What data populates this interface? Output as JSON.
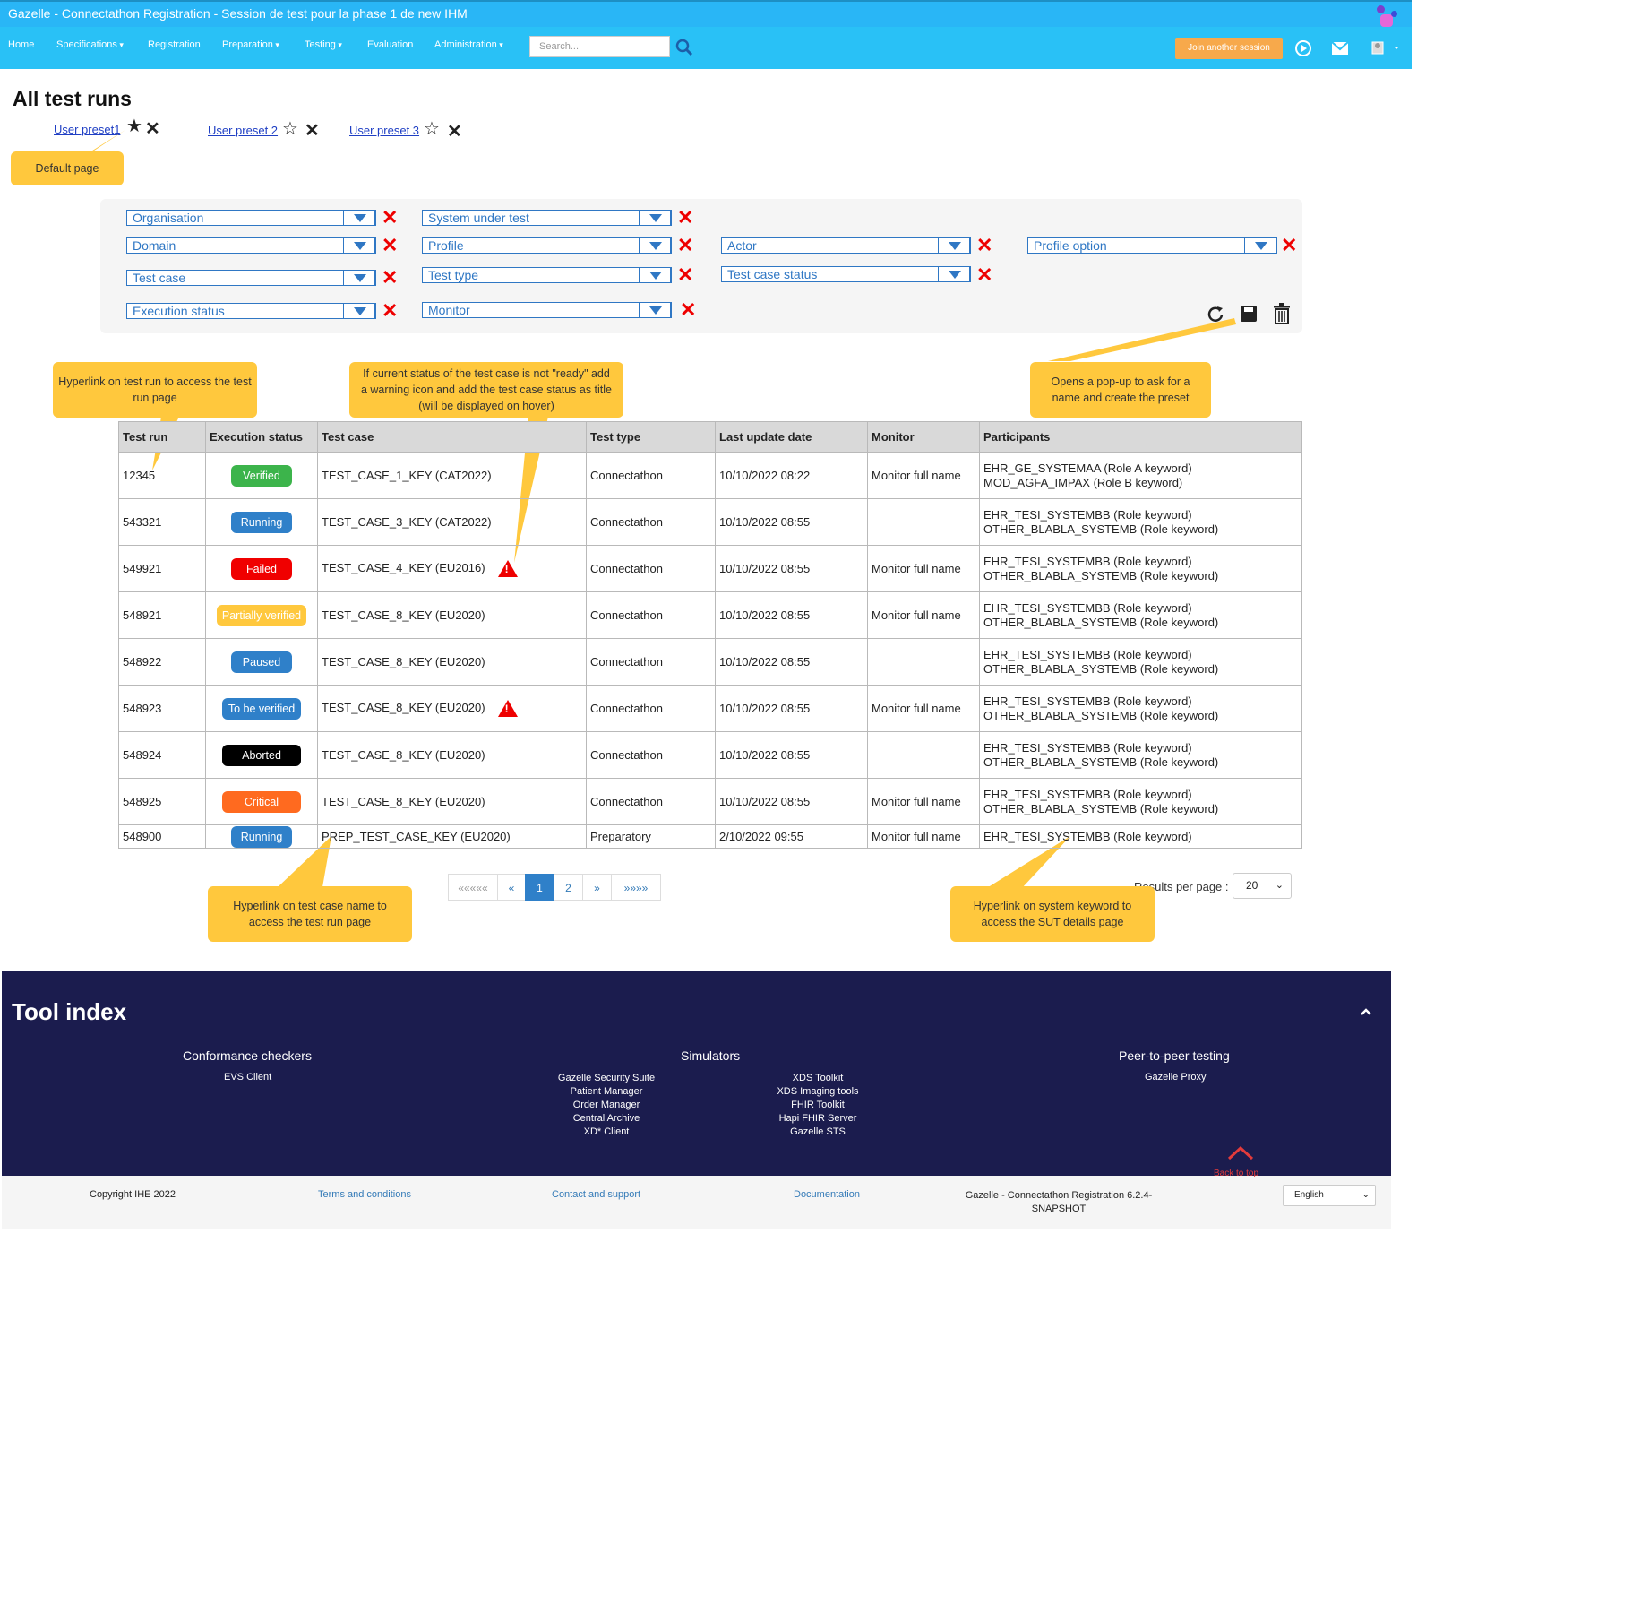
{
  "window": {
    "title": "Gazelle - Connectathon Registration - Session de test pour la phase 1 de new IHM"
  },
  "nav": {
    "items": [
      {
        "label": "Home",
        "dropdown": false
      },
      {
        "label": "Specifications",
        "dropdown": true
      },
      {
        "label": "Registration",
        "dropdown": false
      },
      {
        "label": "Preparation",
        "dropdown": true
      },
      {
        "label": "Testing",
        "dropdown": true
      },
      {
        "label": "Evaluation",
        "dropdown": false
      },
      {
        "label": "Administration",
        "dropdown": true
      }
    ],
    "search_placeholder": "Search...",
    "join_label": "Join another session"
  },
  "page": {
    "title": "All test runs",
    "presets": [
      "User preset1",
      "User preset 2",
      "User preset 3"
    ]
  },
  "callouts": {
    "default_page": "Default page",
    "test_run_link": "Hyperlink on test run to access the test run page",
    "warning_icon": "If current status of the test case is not \"ready\" add a warning icon and add the test case status as title (will be displayed on hover)",
    "create_preset": "Opens a pop-up to ask for a name and create the preset",
    "test_case_link": "Hyperlink on test case name to access the test run page",
    "system_link": "Hyperlink on system keyword to access the SUT details page"
  },
  "filters": {
    "organisation": "Organisation",
    "system_under_test": "System under test",
    "domain": "Domain",
    "profile": "Profile",
    "actor": "Actor",
    "profile_option": "Profile option",
    "test_case": "Test case",
    "test_type": "Test type",
    "test_case_status": "Test case status",
    "execution_status": "Execution status",
    "monitor": "Monitor"
  },
  "table": {
    "headers": [
      "Test run",
      "Execution status",
      "Test case",
      "Test type",
      "Last update date",
      "Monitor",
      "Participants"
    ],
    "rows": [
      {
        "id": "12345",
        "status": "Verified",
        "color": "#3cb44b",
        "test_case": "TEST_CASE_1_KEY (CAT2022)",
        "warn": false,
        "type": "Connectathon",
        "date": "10/10/2022 08:22",
        "monitor": "Monitor full name",
        "p1": "EHR_GE_SYSTEMAA (Role A keyword)",
        "p2": "MOD_AGFA_IMPAX (Role B keyword)"
      },
      {
        "id": "543321",
        "status": "Running",
        "color": "#2f80c9",
        "test_case": "TEST_CASE_3_KEY (CAT2022)",
        "warn": false,
        "type": "Connectathon",
        "date": "10/10/2022 08:55",
        "monitor": "",
        "p1": "EHR_TESI_SYSTEMBB (Role keyword)",
        "p2": "OTHER_BLABLA_SYSTEMB (Role keyword)"
      },
      {
        "id": "549921",
        "status": "Failed",
        "color": "#f00000",
        "test_case": "TEST_CASE_4_KEY (EU2016)",
        "warn": true,
        "type": "Connectathon",
        "date": "10/10/2022 08:55",
        "monitor": "Monitor full name",
        "p1": "EHR_TESI_SYSTEMBB (Role keyword)",
        "p2": "OTHER_BLABLA_SYSTEMB (Role keyword)"
      },
      {
        "id": "548921",
        "status": "Partially verified",
        "color": "#ffc83d",
        "test_case": "TEST_CASE_8_KEY (EU2020)",
        "warn": false,
        "type": "Connectathon",
        "date": "10/10/2022 08:55",
        "monitor": "Monitor full name",
        "p1": "EHR_TESI_SYSTEMBB (Role keyword)",
        "p2": "OTHER_BLABLA_SYSTEMB (Role keyword)"
      },
      {
        "id": "548922",
        "status": "Paused",
        "color": "#2f80c9",
        "test_case": "TEST_CASE_8_KEY (EU2020)",
        "warn": false,
        "type": "Connectathon",
        "date": "10/10/2022 08:55",
        "monitor": "",
        "p1": "EHR_TESI_SYSTEMBB (Role keyword)",
        "p2": "OTHER_BLABLA_SYSTEMB (Role keyword)"
      },
      {
        "id": "548923",
        "status": "To be verified",
        "color": "#2f80c9",
        "test_case": "TEST_CASE_8_KEY (EU2020)",
        "warn": true,
        "type": "Connectathon",
        "date": "10/10/2022 08:55",
        "monitor": "Monitor full name",
        "p1": "EHR_TESI_SYSTEMBB (Role keyword)",
        "p2": "OTHER_BLABLA_SYSTEMB (Role keyword)"
      },
      {
        "id": "548924",
        "status": "Aborted",
        "color": "#000000",
        "test_case": "TEST_CASE_8_KEY (EU2020)",
        "warn": false,
        "type": "Connectathon",
        "date": "10/10/2022 08:55",
        "monitor": "",
        "p1": "EHR_TESI_SYSTEMBB (Role keyword)",
        "p2": "OTHER_BLABLA_SYSTEMB (Role keyword)"
      },
      {
        "id": "548925",
        "status": "Critical",
        "color": "#ff6a1f",
        "test_case": "TEST_CASE_8_KEY (EU2020)",
        "warn": false,
        "type": "Connectathon",
        "date": "10/10/2022 08:55",
        "monitor": "Monitor full name",
        "p1": "EHR_TESI_SYSTEMBB (Role keyword)",
        "p2": "OTHER_BLABLA_SYSTEMB (Role keyword)"
      },
      {
        "id": "548900",
        "status": "Running",
        "color": "#2f80c9",
        "test_case": "PREP_TEST_CASE_KEY (EU2020)",
        "warn": false,
        "type": "Preparatory",
        "date": "2/10/2022 09:55",
        "monitor": "Monitor full name",
        "p1": "EHR_TESI_SYSTEMBB (Role keyword)",
        "p2": ""
      }
    ]
  },
  "pagination": {
    "first": "«««««",
    "prev": "«",
    "pages": [
      "1",
      "2"
    ],
    "current": "1",
    "next": "»",
    "last": "»»»»",
    "results_label": "Results per page :",
    "results_value": "20"
  },
  "footer": {
    "title": "Tool index",
    "columns": {
      "conformance": {
        "title": "Conformance checkers",
        "links": [
          "EVS Client"
        ]
      },
      "simulators": {
        "title": "Simulators",
        "links_left": [
          "Gazelle Security Suite",
          "Patient Manager",
          "Order Manager",
          "Central Archive",
          "XD* Client"
        ],
        "links_right": [
          "XDS Toolkit",
          "XDS Imaging tools",
          "FHIR Toolkit",
          "Hapi FHIR Server",
          "Gazelle STS"
        ]
      },
      "p2p": {
        "title": "Peer-to-peer testing",
        "links": [
          "Gazelle Proxy"
        ]
      }
    },
    "copyright": "Copyright IHE 2022",
    "terms": "Terms and conditions",
    "contact": "Contact and support",
    "documentation": "Documentation",
    "version": "Gazelle - Connectathon Registration 6.2.4-SNAPSHOT",
    "back_to_top": "Back to top",
    "language": "English"
  }
}
